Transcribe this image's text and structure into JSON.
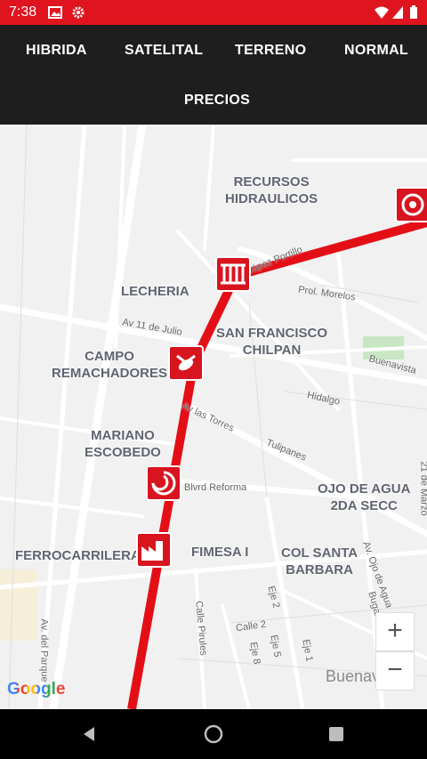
{
  "status_bar": {
    "time": "7:38",
    "icons": [
      "image-icon",
      "gear-icon",
      "wifi-icon",
      "signal-icon",
      "battery-icon"
    ]
  },
  "tabs": [
    "HIBRIDA",
    "SATELITAL",
    "TERRENO",
    "NORMAL",
    "PRECIOS"
  ],
  "map": {
    "areas": [
      "RECURSOS\nHIDRAULICOS",
      "LECHERIA",
      "SAN FRANCISCO\nCHILPAN",
      "CAMPO\nREMACHADORES",
      "MARIANO\nESCOBEDO",
      "OJO DE AGUA\n2DA SECC",
      "FIMESA I",
      "COL SANTA\nBARBARA",
      "FERROCARRILERA"
    ],
    "streets": [
      "Av. López Portillo",
      "Prol. Morelos",
      "Av 11 de Julio",
      "Buenavista",
      "Hidalgo",
      "Av las Torres",
      "Tulipanes",
      "Blvrd Reforma",
      "21 de Marzo",
      "Av. Ojo de Agua",
      "Bugambilias",
      "Eje 2",
      "Calle 2",
      "Eje 8",
      "Eje 5",
      "Eje 1",
      "Calle Pirules",
      "Av. del Parque"
    ],
    "watermark": "Buenavista",
    "markers": [
      "aqueduct-marker-icon",
      "aqueduct-marker-icon",
      "wasp-marker-icon",
      "cyclone-marker-icon",
      "factory-marker-icon",
      "badge-marker-icon"
    ],
    "zoom_in": "+",
    "zoom_out": "−",
    "google_logo": "Google",
    "colors": {
      "route": "#e40f16",
      "brand": "#e0141e"
    }
  },
  "nav": {
    "icons": [
      "back-icon",
      "home-icon",
      "recents-icon"
    ]
  }
}
